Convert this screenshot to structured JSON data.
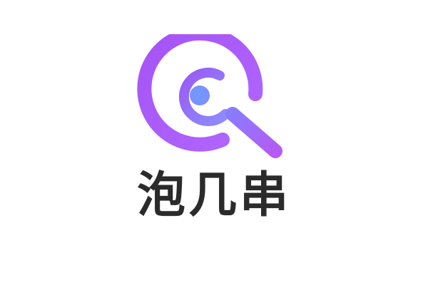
{
  "brand": {
    "name": "泡几串",
    "icon": "search-magnifier-icon",
    "colors": {
      "ring_start": "#a855f7",
      "ring_end": "#9f6bff",
      "lens_dot_start": "#5aa0ff",
      "lens_dot_end": "#b78cff",
      "text": "#2b2b2b",
      "background": "#ffffff"
    }
  }
}
